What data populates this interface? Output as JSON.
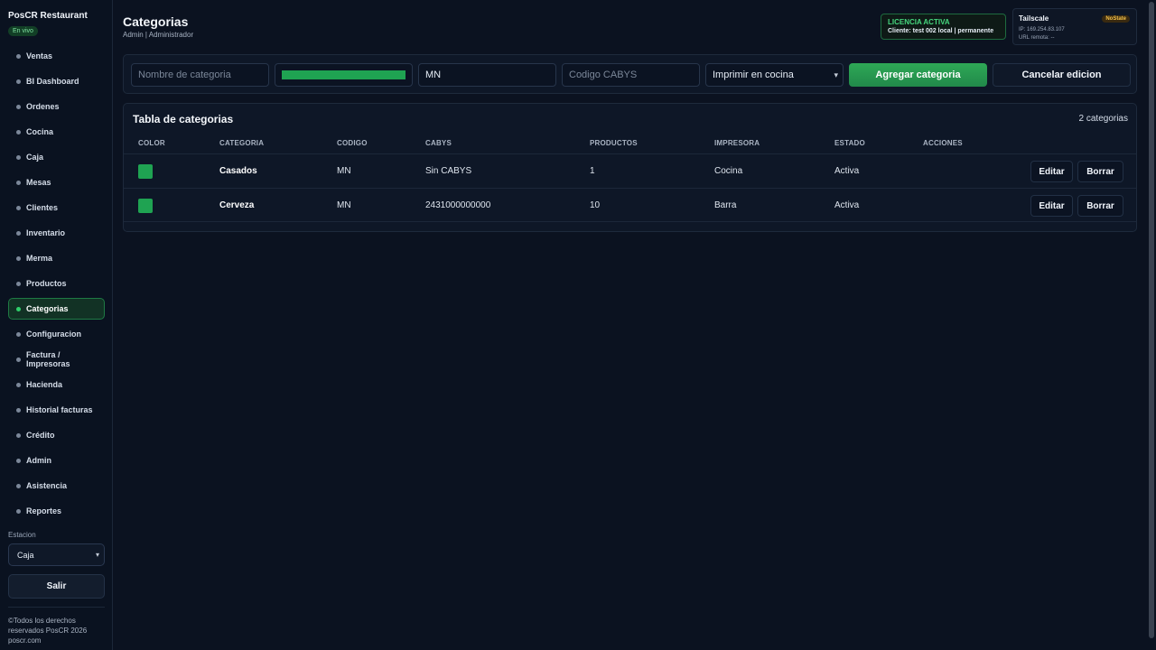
{
  "app": {
    "brand": "PosCR Restaurant",
    "live_badge": "En vivo"
  },
  "sidebar": {
    "items": [
      {
        "label": "Ventas"
      },
      {
        "label": "BI Dashboard"
      },
      {
        "label": "Ordenes"
      },
      {
        "label": "Cocina"
      },
      {
        "label": "Caja"
      },
      {
        "label": "Mesas"
      },
      {
        "label": "Clientes"
      },
      {
        "label": "Inventario"
      },
      {
        "label": "Merma"
      },
      {
        "label": "Productos"
      },
      {
        "label": "Categorias",
        "active": true
      },
      {
        "label": "Configuracion"
      },
      {
        "label": "Factura / Impresoras"
      },
      {
        "label": "Hacienda"
      },
      {
        "label": "Historial facturas"
      },
      {
        "label": "Crédito"
      },
      {
        "label": "Admin"
      },
      {
        "label": "Asistencia"
      },
      {
        "label": "Reportes"
      }
    ],
    "station_label": "Estacion",
    "station_value": "Caja",
    "logout_label": "Salir",
    "footer": "©Todos los derechos reservados PosCR 2026 poscr.com"
  },
  "header": {
    "title": "Categorias",
    "subtitle": "Admin | Administrador",
    "license": {
      "title": "LICENCIA ACTIVA",
      "client": "Cliente: test 002 local | permanente"
    },
    "tailscale": {
      "title": "Tailscale",
      "badge": "NoState",
      "ip": "IP: 169.254.83.107",
      "url": "URL remota: --"
    }
  },
  "form": {
    "name_placeholder": "Nombre de categoria",
    "color_value": "#1fa352",
    "code_value": "MN",
    "cabys_placeholder": "Codigo CABYS",
    "printer_value": "Imprimir en cocina",
    "add_label": "Agregar categoria",
    "cancel_label": "Cancelar edicion"
  },
  "table": {
    "title": "Tabla de categorias",
    "count": "2 categorias",
    "columns": [
      "COLOR",
      "CATEGORIA",
      "CODIGO",
      "CABYS",
      "PRODUCTOS",
      "IMPRESORA",
      "ESTADO",
      "ACCIONES"
    ],
    "rows": [
      {
        "color": "#1fa352",
        "categoria": "Casados",
        "codigo": "MN",
        "cabys": "Sin CABYS",
        "productos": "1",
        "impresora": "Cocina",
        "estado": "Activa"
      },
      {
        "color": "#1fa352",
        "categoria": "Cerveza",
        "codigo": "MN",
        "cabys": "2431000000000",
        "productos": "10",
        "impresora": "Barra",
        "estado": "Activa"
      }
    ],
    "edit_label": "Editar",
    "delete_label": "Borrar"
  },
  "colors": {
    "accent": "#2ea856",
    "background": "#0b1220",
    "panel": "#0e1727"
  }
}
